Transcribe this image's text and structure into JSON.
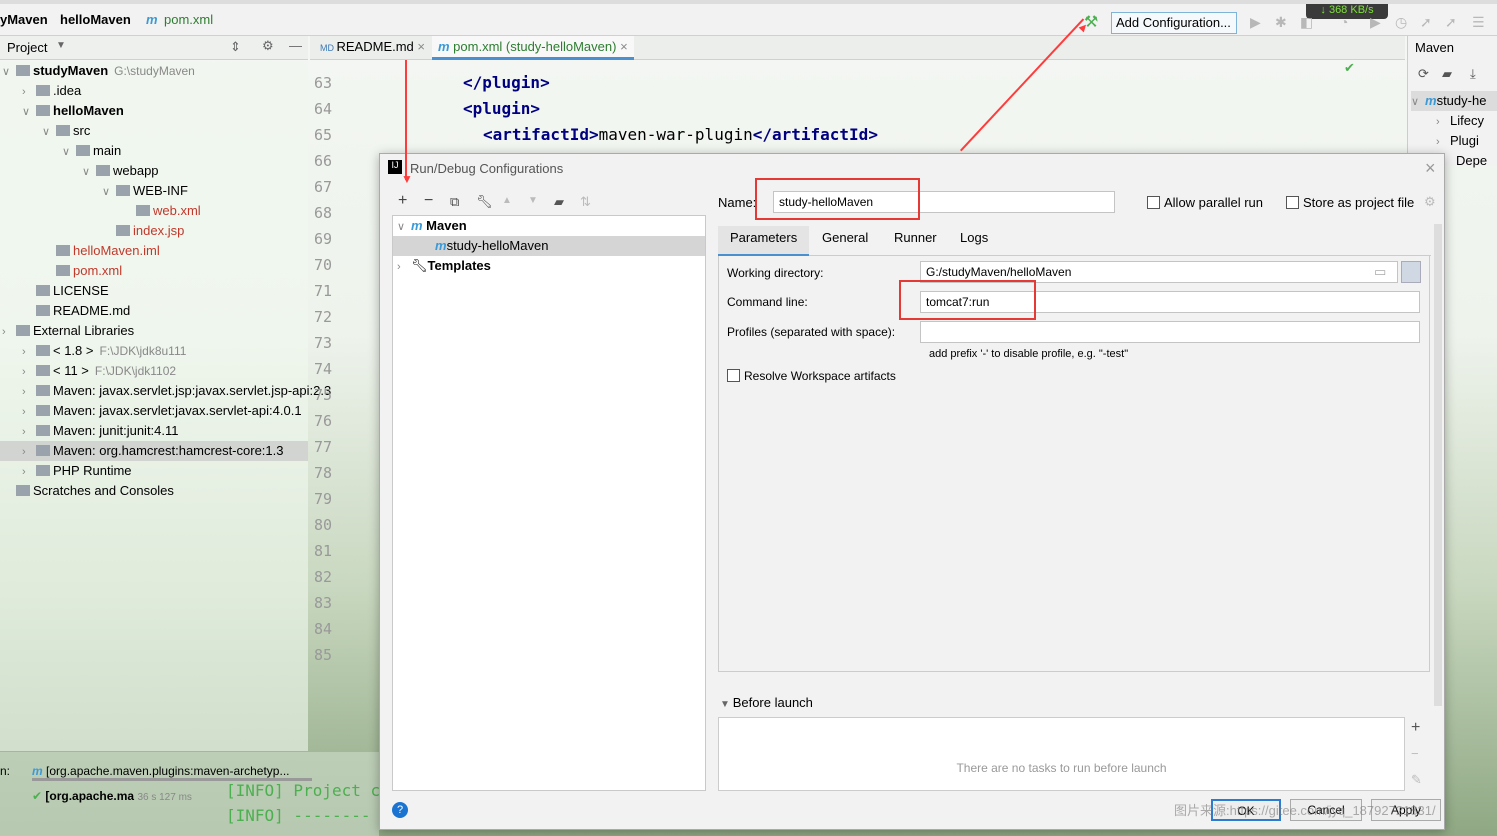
{
  "breadcrumb": [
    "yMaven",
    "helloMaven",
    "pom.xml"
  ],
  "toolbar": {
    "add_configuration": "Add Configuration...",
    "download_speed": "↓ 368 KB/s"
  },
  "project_panel": {
    "title": "Project",
    "tree": [
      {
        "label": "studyMaven",
        "hint": "G:\\studyMaven",
        "depth": 0,
        "bold": true
      },
      {
        "label": ".idea",
        "depth": 1
      },
      {
        "label": "helloMaven",
        "depth": 1,
        "bold": true
      },
      {
        "label": "src",
        "depth": 2
      },
      {
        "label": "main",
        "depth": 3
      },
      {
        "label": "webapp",
        "depth": 4
      },
      {
        "label": "WEB-INF",
        "depth": 5
      },
      {
        "label": "web.xml",
        "depth": 6,
        "red": true
      },
      {
        "label": "index.jsp",
        "depth": 5,
        "red": true
      },
      {
        "label": "helloMaven.iml",
        "depth": 2,
        "red": true
      },
      {
        "label": "pom.xml",
        "depth": 2,
        "red": true
      },
      {
        "label": "LICENSE",
        "depth": 1
      },
      {
        "label": "README.md",
        "depth": 1
      },
      {
        "label": "External Libraries",
        "depth": 0
      },
      {
        "label": "< 1.8 >",
        "hint": "F:\\JDK\\jdk8u111",
        "depth": 1
      },
      {
        "label": "< 11 >",
        "hint": "F:\\JDK\\jdk1102",
        "depth": 1
      },
      {
        "label": "Maven: javax.servlet.jsp:javax.servlet.jsp-api:2.3",
        "depth": 1
      },
      {
        "label": "Maven: javax.servlet:javax.servlet-api:4.0.1",
        "depth": 1
      },
      {
        "label": "Maven: junit:junit:4.11",
        "depth": 1
      },
      {
        "label": "Maven: org.hamcrest:hamcrest-core:1.3",
        "depth": 1
      },
      {
        "label": "PHP Runtime",
        "depth": 1
      },
      {
        "label": "Scratches and Consoles",
        "depth": 0
      }
    ]
  },
  "editor": {
    "tabs": [
      "README.md",
      "pom.xml (study-helloMaven)"
    ],
    "line_numbers": [
      "63",
      "64",
      "65",
      "66",
      "67",
      "68",
      "69",
      "70",
      "71",
      "72",
      "73",
      "74",
      "75",
      "76",
      "77",
      "78",
      "79",
      "80",
      "81",
      "82",
      "83",
      "84",
      "85"
    ],
    "code": {
      "l63": "</plugin>",
      "l64": "<plugin>",
      "l65_open": "<artifactId>",
      "l65_text": "maven-war-plugin",
      "l65_close": "</artifactId>"
    }
  },
  "maven_panel": {
    "title": "Maven",
    "items": [
      "study-he",
      "Lifecy",
      "Plugi",
      "Depe"
    ]
  },
  "dialog": {
    "title": "Run/Debug Configurations",
    "tree": {
      "maven": "Maven",
      "config": "study-helloMaven",
      "templates": "Templates"
    },
    "name_label": "Name:",
    "name_value": "study-helloMaven",
    "allow_parallel": "Allow parallel run",
    "store_project": "Store as project file",
    "tabs": [
      "Parameters",
      "General",
      "Runner",
      "Logs"
    ],
    "working_dir_label": "Working directory:",
    "working_dir": "G:/studyMaven/helloMaven",
    "command_line_label": "Command line:",
    "command_line": "tomcat7:run",
    "profiles_label": "Profiles (separated with space):",
    "profiles": "",
    "profiles_hint": "add prefix '-' to disable profile, e.g. \"-test\"",
    "resolve_workspace": "Resolve Workspace artifacts",
    "before_launch": "Before launch",
    "no_tasks": "There are no tasks to run before launch",
    "ok": "OK",
    "cancel": "Cancel",
    "apply": "Apply"
  },
  "run_panel": {
    "tab": "[org.apache.maven.plugins:maven-archetyp...",
    "item": "[org.apache.ma",
    "time": "36 s 127 ms",
    "log1": "[INFO] Project c",
    "log2": "[INFO] --------"
  },
  "watermark": "图片来源:https://gitee.com/jyq_18792721831/",
  "colors": {
    "highlight": "#e53935",
    "accent": "#3c9ad6"
  }
}
